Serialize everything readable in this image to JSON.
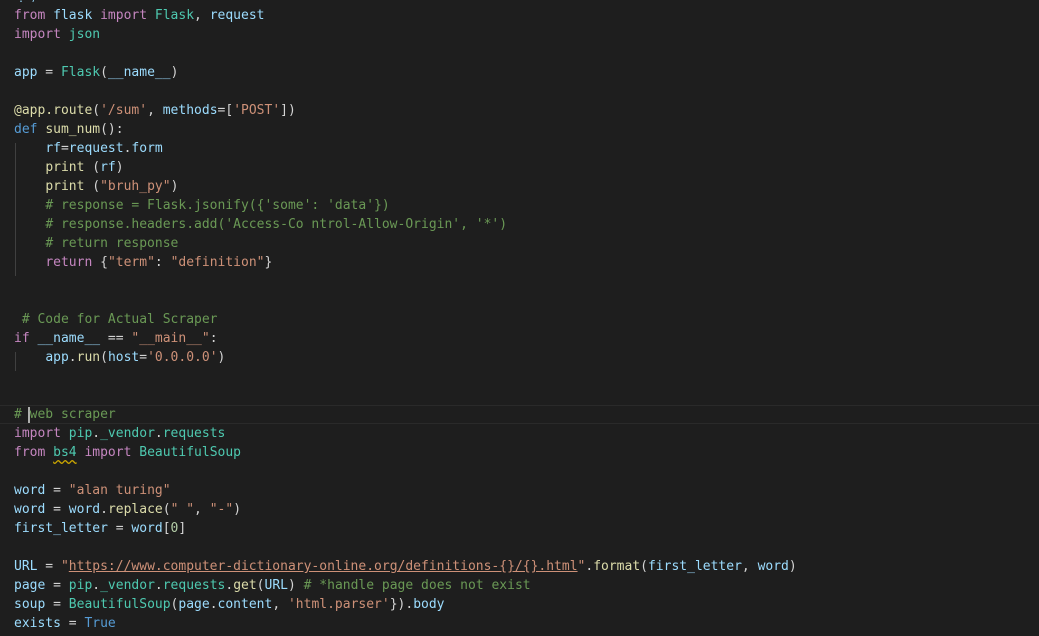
{
  "theme": {
    "background": "#1e1e1e",
    "text": "#d4d4d4",
    "keyword": "#c586c0",
    "def_keyword": "#569cd6",
    "function": "#dcdcaa",
    "variable": "#9cdcfe",
    "class": "#4ec9b0",
    "string": "#ce9178",
    "number": "#b5cea8",
    "comment": "#6a9955"
  },
  "top_fragment": "' . )",
  "lines": [
    {
      "tokens": [
        [
          "kw",
          "from"
        ],
        [
          "op",
          " "
        ],
        [
          "var",
          "flask"
        ],
        [
          "op",
          " "
        ],
        [
          "kw",
          "import"
        ],
        [
          "op",
          " "
        ],
        [
          "cls",
          "Flask"
        ],
        [
          "op",
          ", "
        ],
        [
          "var",
          "request"
        ]
      ]
    },
    {
      "tokens": [
        [
          "kw",
          "import"
        ],
        [
          "op",
          " "
        ],
        [
          "cls",
          "json"
        ]
      ]
    },
    {
      "tokens": []
    },
    {
      "tokens": [
        [
          "var",
          "app"
        ],
        [
          "op",
          " = "
        ],
        [
          "cls",
          "Flask"
        ],
        [
          "op",
          "("
        ],
        [
          "var",
          "__name__"
        ],
        [
          "op",
          ")"
        ]
      ]
    },
    {
      "tokens": []
    },
    {
      "tokens": [
        [
          "fn",
          "@app.route"
        ],
        [
          "op",
          "("
        ],
        [
          "str",
          "'/sum'"
        ],
        [
          "op",
          ", "
        ],
        [
          "var",
          "methods"
        ],
        [
          "op",
          "=["
        ],
        [
          "str",
          "'POST'"
        ],
        [
          "op",
          "])"
        ]
      ]
    },
    {
      "tokens": [
        [
          "def",
          "def"
        ],
        [
          "op",
          " "
        ],
        [
          "fn",
          "sum_num"
        ],
        [
          "op",
          "():"
        ]
      ]
    },
    {
      "tokens": [
        [
          "op",
          "    "
        ],
        [
          "var",
          "rf"
        ],
        [
          "op",
          "="
        ],
        [
          "var",
          "request"
        ],
        [
          "op",
          "."
        ],
        [
          "var",
          "form"
        ]
      ]
    },
    {
      "tokens": [
        [
          "op",
          "    "
        ],
        [
          "fn",
          "print"
        ],
        [
          "op",
          " ("
        ],
        [
          "var",
          "rf"
        ],
        [
          "op",
          ")"
        ]
      ]
    },
    {
      "tokens": [
        [
          "op",
          "    "
        ],
        [
          "fn",
          "print"
        ],
        [
          "op",
          " ("
        ],
        [
          "str",
          "\"bruh_py\""
        ],
        [
          "op",
          ")"
        ]
      ]
    },
    {
      "tokens": [
        [
          "op",
          "    "
        ],
        [
          "cmt",
          "# response = Flask.jsonify({'some': 'data'})"
        ]
      ]
    },
    {
      "tokens": [
        [
          "op",
          "    "
        ],
        [
          "cmt",
          "# response.headers.add('Access-Co ntrol-Allow-Origin', '*')"
        ]
      ]
    },
    {
      "tokens": [
        [
          "op",
          "    "
        ],
        [
          "cmt",
          "# return response"
        ]
      ]
    },
    {
      "tokens": [
        [
          "op",
          "    "
        ],
        [
          "kw",
          "return"
        ],
        [
          "op",
          " {"
        ],
        [
          "str",
          "\"term\""
        ],
        [
          "op",
          ": "
        ],
        [
          "str",
          "\"definition\""
        ],
        [
          "op",
          "}"
        ]
      ]
    },
    {
      "tokens": []
    },
    {
      "tokens": []
    },
    {
      "tokens": [
        [
          "op",
          " "
        ],
        [
          "cmt",
          "# Code for Actual Scraper"
        ]
      ]
    },
    {
      "tokens": [
        [
          "kw",
          "if"
        ],
        [
          "op",
          " "
        ],
        [
          "var",
          "__name__"
        ],
        [
          "op",
          " == "
        ],
        [
          "str",
          "\"__main__\""
        ],
        [
          "op",
          ":"
        ]
      ]
    },
    {
      "tokens": [
        [
          "op",
          "    "
        ],
        [
          "var",
          "app"
        ],
        [
          "op",
          "."
        ],
        [
          "fn",
          "run"
        ],
        [
          "op",
          "("
        ],
        [
          "var",
          "host"
        ],
        [
          "op",
          "="
        ],
        [
          "str",
          "'0.0.0.0'"
        ],
        [
          "op",
          ")"
        ]
      ]
    },
    {
      "tokens": []
    },
    {
      "tokens": []
    },
    {
      "tokens": [
        [
          "cmt",
          "# web scraper"
        ]
      ]
    },
    {
      "tokens": [
        [
          "kw",
          "import"
        ],
        [
          "op",
          " "
        ],
        [
          "cls",
          "pip"
        ],
        [
          "op",
          "."
        ],
        [
          "cls",
          "_vendor"
        ],
        [
          "op",
          "."
        ],
        [
          "cls",
          "requests"
        ]
      ]
    },
    {
      "tokens": [
        [
          "kw",
          "from"
        ],
        [
          "op",
          " "
        ],
        [
          "cls-squiggle",
          "bs4"
        ],
        [
          "op",
          " "
        ],
        [
          "kw",
          "import"
        ],
        [
          "op",
          " "
        ],
        [
          "cls",
          "BeautifulSoup"
        ]
      ]
    },
    {
      "tokens": []
    },
    {
      "tokens": [
        [
          "var",
          "word"
        ],
        [
          "op",
          " = "
        ],
        [
          "str",
          "\"alan turing\""
        ]
      ]
    },
    {
      "tokens": [
        [
          "var",
          "word"
        ],
        [
          "op",
          " = "
        ],
        [
          "var",
          "word"
        ],
        [
          "op",
          "."
        ],
        [
          "fn",
          "replace"
        ],
        [
          "op",
          "("
        ],
        [
          "str",
          "\" \""
        ],
        [
          "op",
          ", "
        ],
        [
          "str",
          "\"-\""
        ],
        [
          "op",
          ")"
        ]
      ]
    },
    {
      "tokens": [
        [
          "var",
          "first_letter"
        ],
        [
          "op",
          " = "
        ],
        [
          "var",
          "word"
        ],
        [
          "op",
          "["
        ],
        [
          "num",
          "0"
        ],
        [
          "op",
          "]"
        ]
      ]
    },
    {
      "tokens": []
    },
    {
      "tokens": [
        [
          "var",
          "URL"
        ],
        [
          "op",
          " = "
        ],
        [
          "str",
          "\""
        ],
        [
          "url",
          "https://www.computer-dictionary-online.org/definitions-{}/{}.html"
        ],
        [
          "str",
          "\""
        ],
        [
          "op",
          "."
        ],
        [
          "fn",
          "format"
        ],
        [
          "op",
          "("
        ],
        [
          "var",
          "first_letter"
        ],
        [
          "op",
          ", "
        ],
        [
          "var",
          "word"
        ],
        [
          "op",
          ")"
        ]
      ]
    },
    {
      "tokens": [
        [
          "var",
          "page"
        ],
        [
          "op",
          " = "
        ],
        [
          "cls",
          "pip"
        ],
        [
          "op",
          "."
        ],
        [
          "cls",
          "_vendor"
        ],
        [
          "op",
          "."
        ],
        [
          "cls",
          "requests"
        ],
        [
          "op",
          "."
        ],
        [
          "fn",
          "get"
        ],
        [
          "op",
          "("
        ],
        [
          "var",
          "URL"
        ],
        [
          "op",
          ") "
        ],
        [
          "cmt",
          "# *handle page does not exist"
        ]
      ]
    },
    {
      "tokens": [
        [
          "var",
          "soup"
        ],
        [
          "op",
          " = "
        ],
        [
          "cls",
          "BeautifulSoup"
        ],
        [
          "op",
          "("
        ],
        [
          "var",
          "page"
        ],
        [
          "op",
          "."
        ],
        [
          "var",
          "content"
        ],
        [
          "op",
          ", "
        ],
        [
          "str",
          "'html.parser'"
        ],
        [
          "op",
          "})."
        ],
        [
          "var",
          "body"
        ]
      ]
    },
    {
      "tokens": [
        [
          "var",
          "exists"
        ],
        [
          "op",
          " = "
        ],
        [
          "const",
          "True"
        ]
      ]
    }
  ]
}
